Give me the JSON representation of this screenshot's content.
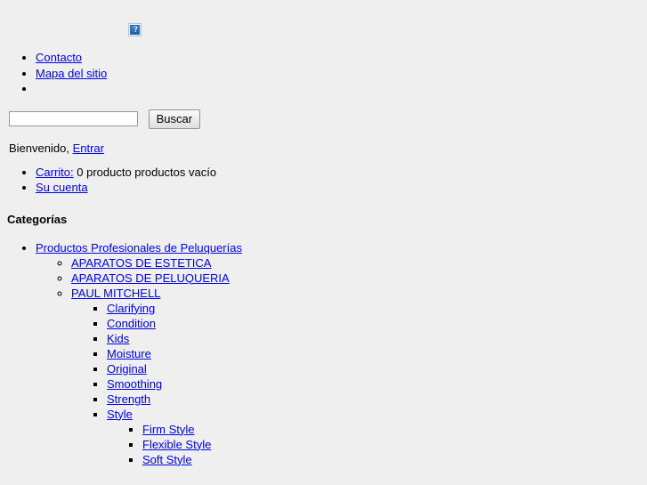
{
  "logo": {
    "icon": "broken-image-icon",
    "alt": "?"
  },
  "top_nav": {
    "items": [
      {
        "label": "Contacto",
        "link": true
      },
      {
        "label": "Mapa del sitio",
        "link": true
      },
      {
        "label": "",
        "link": false
      }
    ]
  },
  "search": {
    "value": "",
    "placeholder": "",
    "button_label": "Buscar"
  },
  "account": {
    "greeting": "Bienvenido,",
    "login_label": "Entrar",
    "cart_label": "Carrito:",
    "cart_summary": "0 producto productos vacío",
    "my_account_label": "Su cuenta"
  },
  "categories": {
    "title": "Categorías",
    "root": {
      "label": "Productos Profesionales de Peluquerías",
      "children": [
        {
          "label": "APARATOS DE ESTETICA",
          "children": []
        },
        {
          "label": "APARATOS DE PELUQUERIA",
          "children": []
        },
        {
          "label": "PAUL MITCHELL",
          "children": [
            {
              "label": "Clarifying",
              "children": []
            },
            {
              "label": "Condition",
              "children": []
            },
            {
              "label": "Kids",
              "children": []
            },
            {
              "label": "Moisture",
              "children": []
            },
            {
              "label": "Original",
              "children": []
            },
            {
              "label": "Smoothing",
              "children": []
            },
            {
              "label": "Strength",
              "children": []
            },
            {
              "label": "Style",
              "children": [
                {
                  "label": "Firm Style",
                  "children": []
                },
                {
                  "label": "Flexible Style",
                  "children": []
                },
                {
                  "label": "Soft Style",
                  "children": []
                }
              ]
            }
          ]
        }
      ]
    }
  },
  "colors": {
    "background": "#efefef",
    "link": "#0000ee",
    "text": "#000000"
  }
}
